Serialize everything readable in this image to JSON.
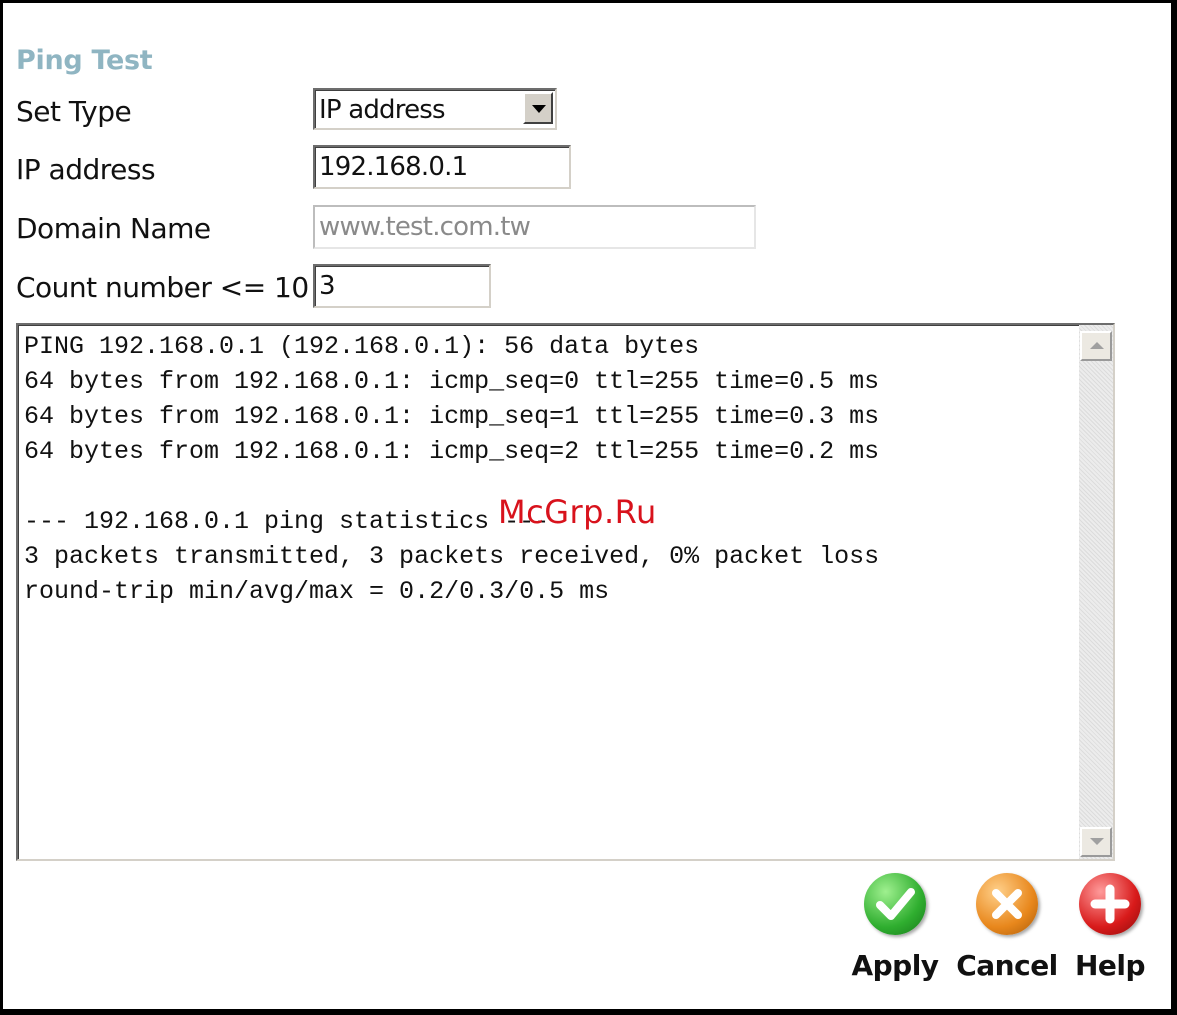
{
  "page_title": "Ping Test",
  "form": {
    "set_type_label": "Set Type",
    "set_type_value": "IP address",
    "ip_label": "IP address",
    "ip_value": "192.168.0.1",
    "domain_label": "Domain Name",
    "domain_value": "www.test.com.tw",
    "count_label": "Count number <= 10",
    "count_value": "3"
  },
  "output_text": "PING 192.168.0.1 (192.168.0.1): 56 data bytes\n64 bytes from 192.168.0.1: icmp_seq=0 ttl=255 time=0.5 ms\n64 bytes from 192.168.0.1: icmp_seq=1 ttl=255 time=0.3 ms\n64 bytes from 192.168.0.1: icmp_seq=2 ttl=255 time=0.2 ms\n\n--- 192.168.0.1 ping statistics ---\n3 packets transmitted, 3 packets received, 0% packet loss\nround-trip min/avg/max = 0.2/0.3/0.5 ms",
  "watermark": "McGrp.Ru",
  "actions": {
    "apply": {
      "label": "Apply",
      "icon": "checkmark-icon",
      "color": "#2fae2f"
    },
    "cancel": {
      "label": "Cancel",
      "icon": "x-icon",
      "color": "#e8871c"
    },
    "help": {
      "label": "Help",
      "icon": "plus-icon",
      "color": "#d81a1a"
    }
  },
  "colors": {
    "title": "#8fb5c2",
    "watermark": "#d8121c"
  }
}
